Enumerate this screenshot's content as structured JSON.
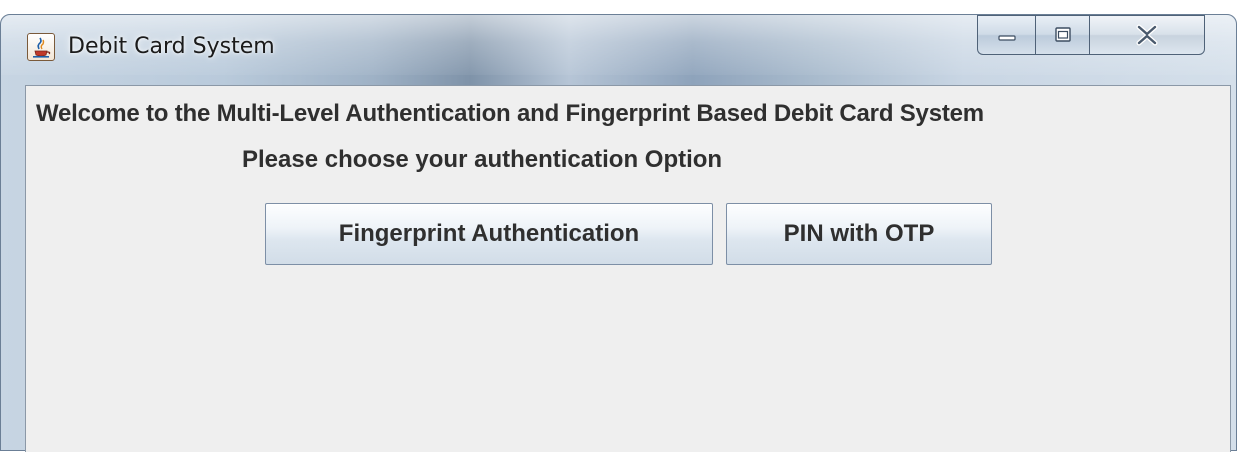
{
  "window": {
    "title": "Debit Card System",
    "app_icon": "java-cup-icon",
    "caption_buttons": [
      "minimize-icon",
      "maximize-icon",
      "close-icon"
    ]
  },
  "content": {
    "welcome_text": "Welcome to the Multi-Level Authentication and Fingerprint  Based Debit Card System",
    "prompt_text": "Please choose your authentication Option",
    "buttons": {
      "fingerprint_label": "Fingerprint Authentication",
      "pin_otp_label": "PIN with OTP"
    }
  }
}
